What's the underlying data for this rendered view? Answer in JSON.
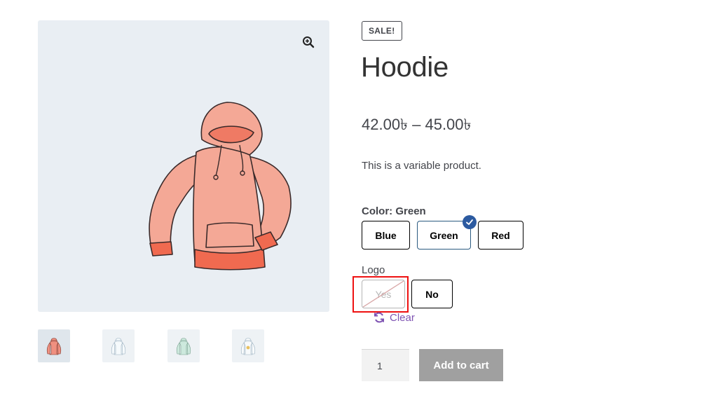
{
  "product": {
    "sale_badge": "SALE!",
    "title": "Hoodie",
    "price_range": "42.00৳ – 45.00৳",
    "description": "This is a variable product."
  },
  "gallery": {
    "zoom_icon": "zoom-in-icon",
    "main_image": "pink-hoodie-image",
    "thumbnails": [
      "pink-hoodie",
      "white-hoodie",
      "green-hoodie",
      "white-hoodie-logo"
    ]
  },
  "attributes": {
    "color": {
      "label": "Color:",
      "selected": "Green",
      "options": [
        "Blue",
        "Green",
        "Red"
      ]
    },
    "logo": {
      "label": "Logo",
      "options": [
        "Yes",
        "No"
      ],
      "disabled": [
        "Yes"
      ]
    },
    "clear_label": "Clear"
  },
  "cart": {
    "quantity": "1",
    "add_label": "Add to cart"
  },
  "colors": {
    "accent_purple": "#7f54b3",
    "check_blue": "#2c5aa0",
    "highlight_red": "#ee1111",
    "button_gray": "#a0a0a0"
  }
}
